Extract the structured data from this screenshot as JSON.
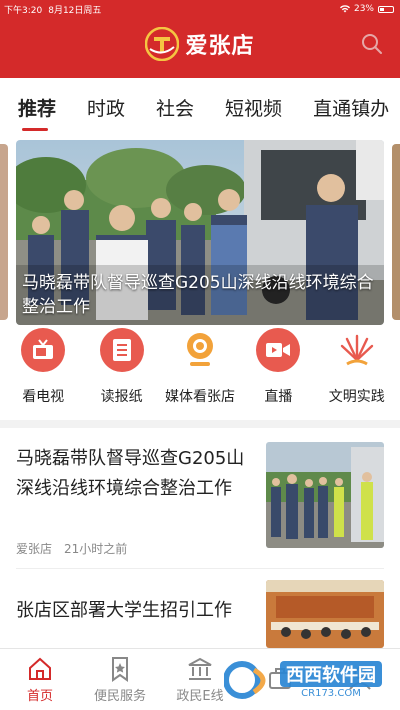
{
  "status_bar": {
    "time": "下午3:20",
    "date": "8月12日周五",
    "battery": "23%"
  },
  "header": {
    "app_name": "爱张店",
    "logo_icon": "zhangdian-logo-icon",
    "search_icon": "search-icon"
  },
  "colors": {
    "brand_red": "#d42a2a",
    "icon_red": "#e85a4f",
    "icon_orange": "#f2a23a",
    "text_muted": "#888888"
  },
  "tabs": [
    {
      "label": "推荐",
      "active": true
    },
    {
      "label": "时政"
    },
    {
      "label": "社会"
    },
    {
      "label": "短视频"
    },
    {
      "label": "直通镇办"
    }
  ],
  "banner": {
    "caption": "马晓磊带队督导巡查G205山深线沿线环境综合整治工作"
  },
  "quick_links": [
    {
      "label": "看电视",
      "icon": "tv-icon"
    },
    {
      "label": "读报纸",
      "icon": "newspaper-icon"
    },
    {
      "label": "媒体看张店",
      "icon": "camera-icon"
    },
    {
      "label": "直播",
      "icon": "live-video-icon"
    },
    {
      "label": "文明实践",
      "icon": "civilization-practice-icon"
    }
  ],
  "news": [
    {
      "title": "马晓磊带队督导巡查G205山深线沿线环境综合整治工作",
      "source": "爱张店",
      "time": "21小时之前"
    },
    {
      "title": "张店区部署大学生招引工作"
    }
  ],
  "bottom_nav": [
    {
      "label": "首页",
      "icon": "home-icon",
      "active": true
    },
    {
      "label": "便民服务",
      "icon": "bookmark-icon"
    },
    {
      "label": "政民E线",
      "icon": "government-icon"
    },
    {
      "label": "",
      "icon": "briefcase-icon"
    },
    {
      "label": "",
      "icon": "user-icon"
    }
  ],
  "watermark": {
    "title": "西西软件园",
    "url": "CR173.COM"
  }
}
